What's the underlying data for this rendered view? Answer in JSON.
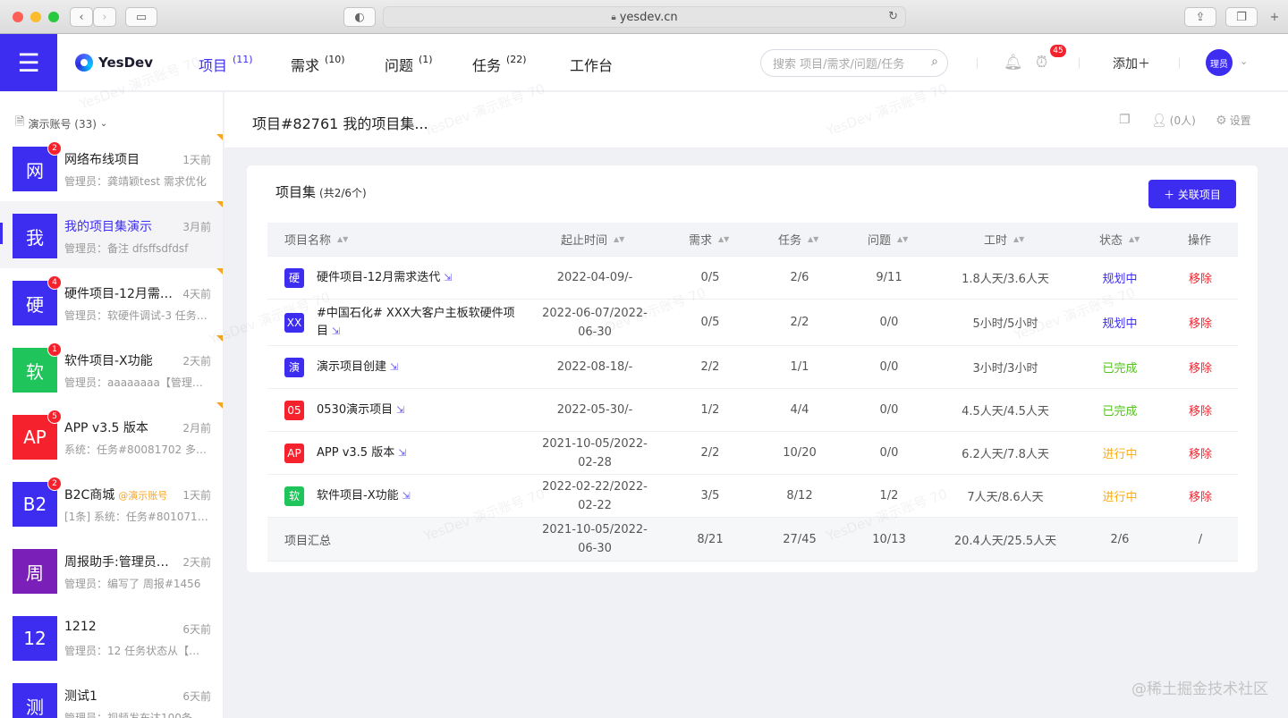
{
  "browser": {
    "url": "yesdev.cn"
  },
  "header": {
    "logo": "YesDev",
    "nav": [
      {
        "label": "项目",
        "count": "(11)",
        "active": true
      },
      {
        "label": "需求",
        "count": "(10)"
      },
      {
        "label": "问题",
        "count": "(1)"
      },
      {
        "label": "任务",
        "count": "(22)"
      },
      {
        "label": "工作台",
        "count": ""
      }
    ],
    "search_placeholder": "搜索 项目/需求/问题/任务",
    "reminder_count": "45",
    "add_label": "添加＋",
    "avatar_text": "理员"
  },
  "sidebar": {
    "account": "演示账号 (33)",
    "items": [
      {
        "avatar": "网",
        "color": "#3d2df0",
        "unread": "2",
        "title": "网络布线项目",
        "tag": "",
        "time": "1天前",
        "preview": "管理员：龚靖颖test 需求优化",
        "corner": true
      },
      {
        "avatar": "我",
        "color": "#3d2df0",
        "unread": "",
        "title": "我的项目集演示",
        "tag": "",
        "time": "3月前",
        "preview": "管理员：备注 dfsffsdfdsf",
        "corner": true,
        "selected": true
      },
      {
        "avatar": "硬",
        "color": "#3d2df0",
        "unread": "4",
        "title": "硬件项目-12月需求迭代",
        "tag": "",
        "time": "4天前",
        "preview": "管理员：软硬件调试-3 任务状态",
        "corner": true
      },
      {
        "avatar": "软",
        "color": "#1fc45a",
        "unread": "1",
        "title": "软件项目-X功能",
        "tag": "",
        "time": "2天前",
        "preview": "管理员：aaaaaaaa【管理员】",
        "corner": true
      },
      {
        "avatar": "AP",
        "color": "#f5222d",
        "unread": "5",
        "title": "APP v3.5 版本",
        "tag": "",
        "time": "2月前",
        "preview": "系统：任务#80081702 多个项目",
        "corner": true
      },
      {
        "avatar": "B2",
        "color": "#3d2df0",
        "unread": "2",
        "title": "B2C商城",
        "tag": "@演示账号",
        "time": "1天前",
        "preview": "[1条] 系统：任务#80107112 状态",
        "corner": false
      },
      {
        "avatar": "周",
        "color": "#7a1fb8",
        "unread": "",
        "title": "周报助手:管理员的周报",
        "tag": "",
        "time": "2天前",
        "preview": "管理员：编写了 周报#1456",
        "corner": false
      },
      {
        "avatar": "12",
        "color": "#3d2df0",
        "unread": "",
        "title": "1212",
        "tag": "",
        "time": "6天前",
        "preview": "管理员：12 任务状态从【进行中】",
        "corner": false
      },
      {
        "avatar": "测",
        "color": "#3d2df0",
        "unread": "",
        "title": "测试1",
        "tag": "",
        "time": "6天前",
        "preview": "管理员：视频发布达100条",
        "corner": false
      }
    ]
  },
  "page": {
    "title": "项目#82761 我的项目集...",
    "members": "(0人)",
    "settings": "设置"
  },
  "card": {
    "title": "项目集",
    "subtitle": "(共2/6个)",
    "link_button": "＋ 关联项目",
    "columns": [
      "项目名称",
      "起止时间",
      "需求",
      "任务",
      "问题",
      "工时",
      "状态",
      "操作"
    ],
    "rows": [
      {
        "icon": "硬",
        "icon_color": "#3d2df0",
        "name": "硬件项目-12月需求迭代",
        "dates": "2022-04-09/-",
        "req": "0/5",
        "task": "2/6",
        "issue": "9/11",
        "hours": "1.8人天/3.6人天",
        "status": "规划中",
        "status_color": "#3d2df0",
        "action": "移除"
      },
      {
        "icon": "XX",
        "icon_color": "#3d2df0",
        "name": "#中国石化# XXX大客户主板软硬件项目",
        "dates": "2022-06-07/2022-06-30",
        "req": "0/5",
        "task": "2/2",
        "issue": "0/0",
        "hours": "5小时/5小时",
        "status": "规划中",
        "status_color": "#3d2df0",
        "action": "移除"
      },
      {
        "icon": "演",
        "icon_color": "#3d2df0",
        "name": "演示项目创建",
        "dates": "2022-08-18/-",
        "req": "2/2",
        "task": "1/1",
        "issue": "0/0",
        "hours": "3小时/3小时",
        "status": "已完成",
        "status_color": "#52c41a",
        "action": "移除"
      },
      {
        "icon": "05",
        "icon_color": "#f5222d",
        "name": "0530演示项目",
        "dates": "2022-05-30/-",
        "req": "1/2",
        "task": "4/4",
        "issue": "0/0",
        "hours": "4.5人天/4.5人天",
        "status": "已完成",
        "status_color": "#52c41a",
        "action": "移除"
      },
      {
        "icon": "AP",
        "icon_color": "#f5222d",
        "name": "APP v3.5 版本",
        "dates": "2021-10-05/2022-02-28",
        "req": "2/2",
        "task": "10/20",
        "issue": "0/0",
        "hours": "6.2人天/7.8人天",
        "status": "进行中",
        "status_color": "#faad14",
        "action": "移除"
      },
      {
        "icon": "软",
        "icon_color": "#1fc45a",
        "name": "软件项目-X功能",
        "dates": "2022-02-22/2022-02-22",
        "req": "3/5",
        "task": "8/12",
        "issue": "1/2",
        "hours": "7人天/8.6人天",
        "status": "进行中",
        "status_color": "#faad14",
        "action": "移除"
      }
    ],
    "summary": {
      "label": "项目汇总",
      "dates": "2021-10-05/2022-06-30",
      "req": "8/21",
      "task": "27/45",
      "issue": "10/13",
      "hours": "20.4人天/25.5人天",
      "status": "2/6",
      "action": "/"
    }
  },
  "watermark": "YesDev 演示账号 70",
  "footer_watermark": "@稀土掘金技术社区"
}
